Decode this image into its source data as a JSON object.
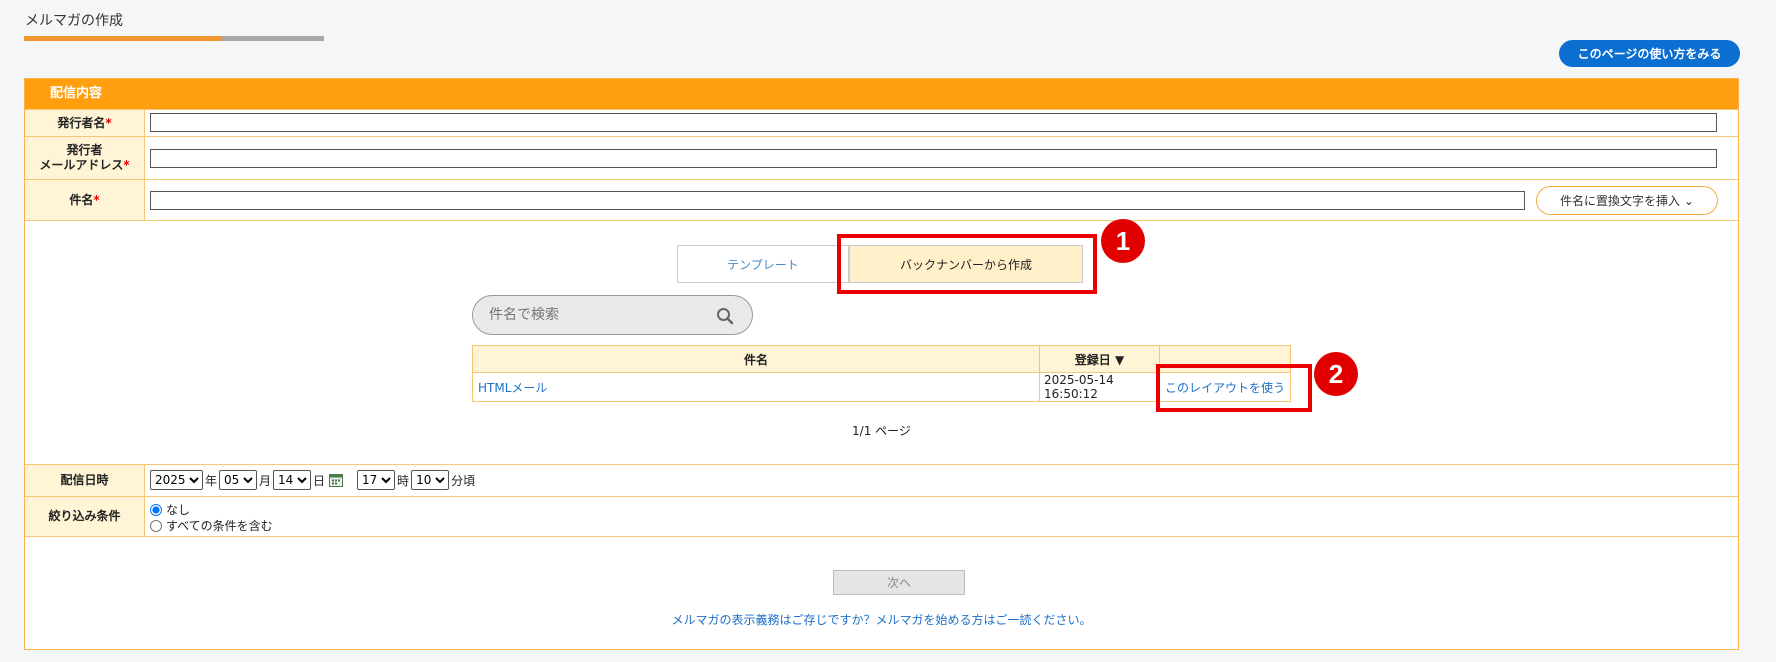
{
  "page": {
    "title": "メルマガの作成",
    "help_button": "このページの使い方をみる",
    "progress_percent": 66
  },
  "panel": {
    "header": "配信内容",
    "sender_name_label": "発行者名",
    "sender_email_label_line1": "発行者",
    "sender_email_label_line2": "メールアドレス",
    "subject_label": "件名",
    "required_mark": "*",
    "insert_button": "件名に置換文字を挿入",
    "tabs": [
      "テンプレート",
      "バックナンバーから作成"
    ],
    "active_tab": "バックナンバーから作成",
    "search_placeholder": "件名で検索",
    "table": {
      "headers": [
        "件名",
        "登録日"
      ],
      "rows": [
        {
          "subject": "HTMLメール",
          "date": "2025-05-14 16:50:12",
          "action": "このレイアウトを使う"
        }
      ]
    },
    "pager": "1/1 ページ",
    "markers": [
      "1",
      "2"
    ]
  },
  "delivery": {
    "label": "配信日時",
    "year": "2025",
    "year_unit": "年",
    "month": "05",
    "month_unit": "月",
    "day": "14",
    "day_unit": "日",
    "hour": "17",
    "hour_unit": "時",
    "minute": "10",
    "minute_unit": "分頃"
  },
  "filter": {
    "label": "絞り込み条件",
    "options": [
      "なし",
      "すべての条件を含む"
    ],
    "selected": "なし"
  },
  "footer": {
    "next_button": "次へ",
    "notice_link": "メルマガの表示義務はご存じですか？メルマガを始める方はご一読ください。"
  },
  "colors": {
    "accent_orange": "#ff9f0f",
    "primary_blue": "#0b6fd1",
    "highlight_red": "#ea0000"
  }
}
